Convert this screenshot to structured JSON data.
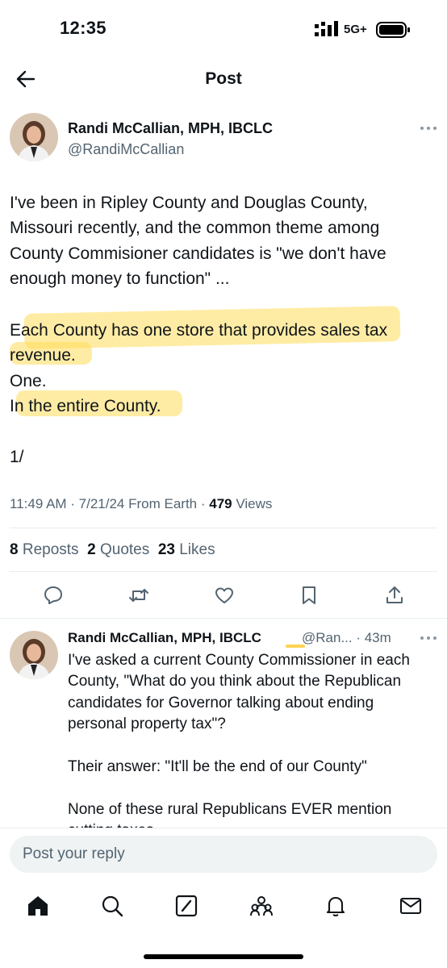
{
  "status_bar": {
    "time": "12:35",
    "network": "5G+"
  },
  "header": {
    "title": "Post"
  },
  "post": {
    "author_name": "Randi McCallian, MPH, IBCLC",
    "author_handle": "@RandiMcCallian",
    "lines": [
      "I've been in Ripley County and Douglas County,",
      "Missouri recently, and the common theme among",
      "County Commisioner candidates is \"we don't have",
      "enough money to function\" ...",
      "",
      "Each County has one store that provides sales tax",
      "revenue.",
      "One.",
      "In the entire County.",
      "",
      "1/"
    ],
    "meta_time": "11:49 AM · 7/21/24 From Earth · ",
    "meta_views_count": "479",
    "meta_views_label": " Views",
    "reposts_count": "8",
    "reposts_label": "Reposts",
    "quotes_count": "2",
    "quotes_label": "Quotes",
    "likes_count": "23",
    "likes_label": "Likes"
  },
  "reply": {
    "author_name": "Randi McCallian, MPH, IBCLC",
    "author_handle_time": "@Ran... · 43m",
    "lines": [
      "I've asked a current County Commissioner in each",
      "County, \"What do you think about the Republican",
      "candidates for Governor talking about ending",
      "personal property tax\"?",
      "",
      "Their answer: \"It'll be the end of our County\"",
      "",
      "None of these rural Republicans EVER mention",
      "cutting taxes"
    ]
  },
  "reply_input": {
    "placeholder": "Post your reply"
  },
  "colors": {
    "text": "#0f1419",
    "muted": "#536471",
    "highlight": "#ffdd5a",
    "accent": "#1d9bf0"
  }
}
